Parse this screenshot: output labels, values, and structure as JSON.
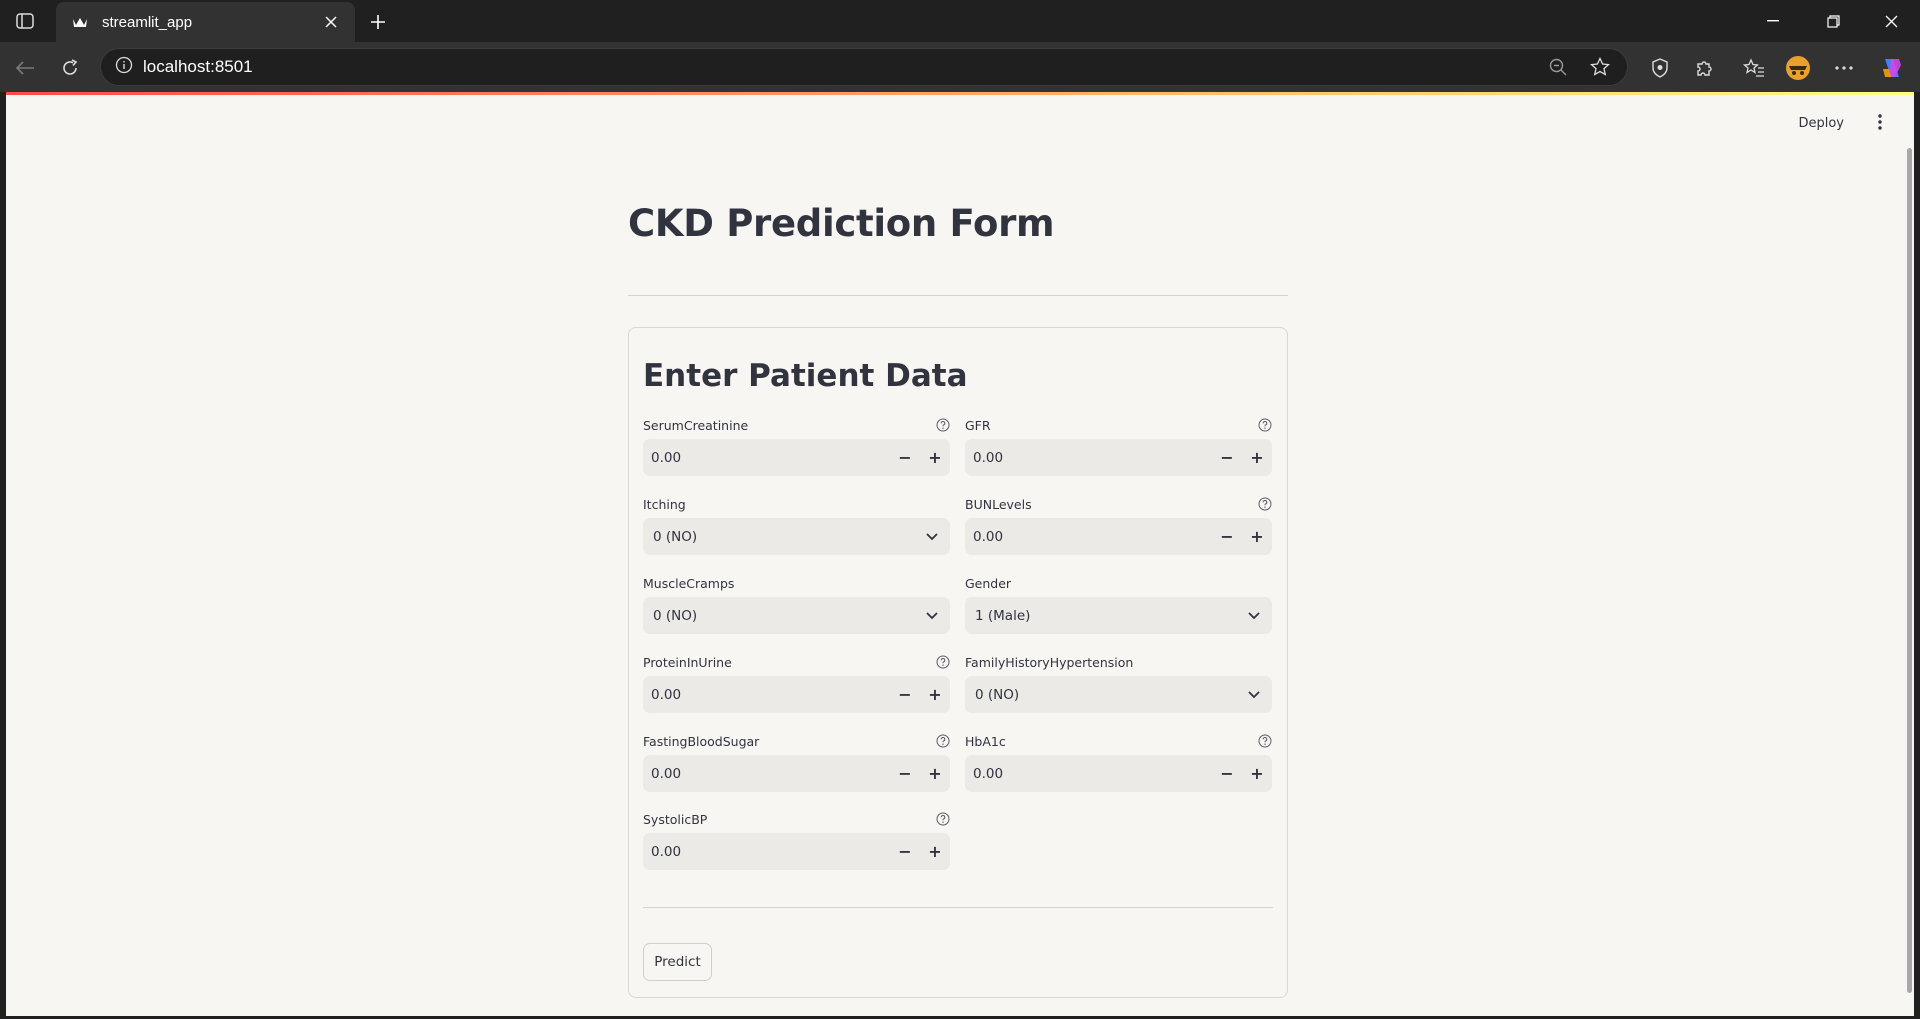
{
  "browser": {
    "tab_title": "streamlit_app",
    "url": "localhost:8501"
  },
  "header": {
    "deploy_label": "Deploy"
  },
  "page": {
    "title": "CKD Prediction Form",
    "form_heading": "Enter Patient Data",
    "predict_label": "Predict"
  },
  "fields": {
    "serum_creatinine": {
      "label": "SerumCreatinine",
      "value": "0.00"
    },
    "gfr": {
      "label": "GFR",
      "value": "0.00"
    },
    "itching": {
      "label": "Itching",
      "value": "0 (NO)"
    },
    "bun_levels": {
      "label": "BUNLevels",
      "value": "0.00"
    },
    "muscle_cramps": {
      "label": "MuscleCramps",
      "value": "0 (NO)"
    },
    "gender": {
      "label": "Gender",
      "value": "1 (Male)"
    },
    "protein_in_urine": {
      "label": "ProteinInUrine",
      "value": "0.00"
    },
    "family_history_hypertension": {
      "label": "FamilyHistoryHypertension",
      "value": "0 (NO)"
    },
    "fasting_blood_sugar": {
      "label": "FastingBloodSugar",
      "value": "0.00"
    },
    "hba1c": {
      "label": "HbA1c",
      "value": "0.00"
    },
    "systolic_bp": {
      "label": "SystolicBP",
      "value": "0.00"
    }
  },
  "stepper": {
    "minus": "−",
    "plus": "+"
  },
  "colors": {
    "accent": "#ff4b4b",
    "page_bg": "#f8f6f3",
    "input_bg": "#ebeae7",
    "text": "#31333f"
  }
}
